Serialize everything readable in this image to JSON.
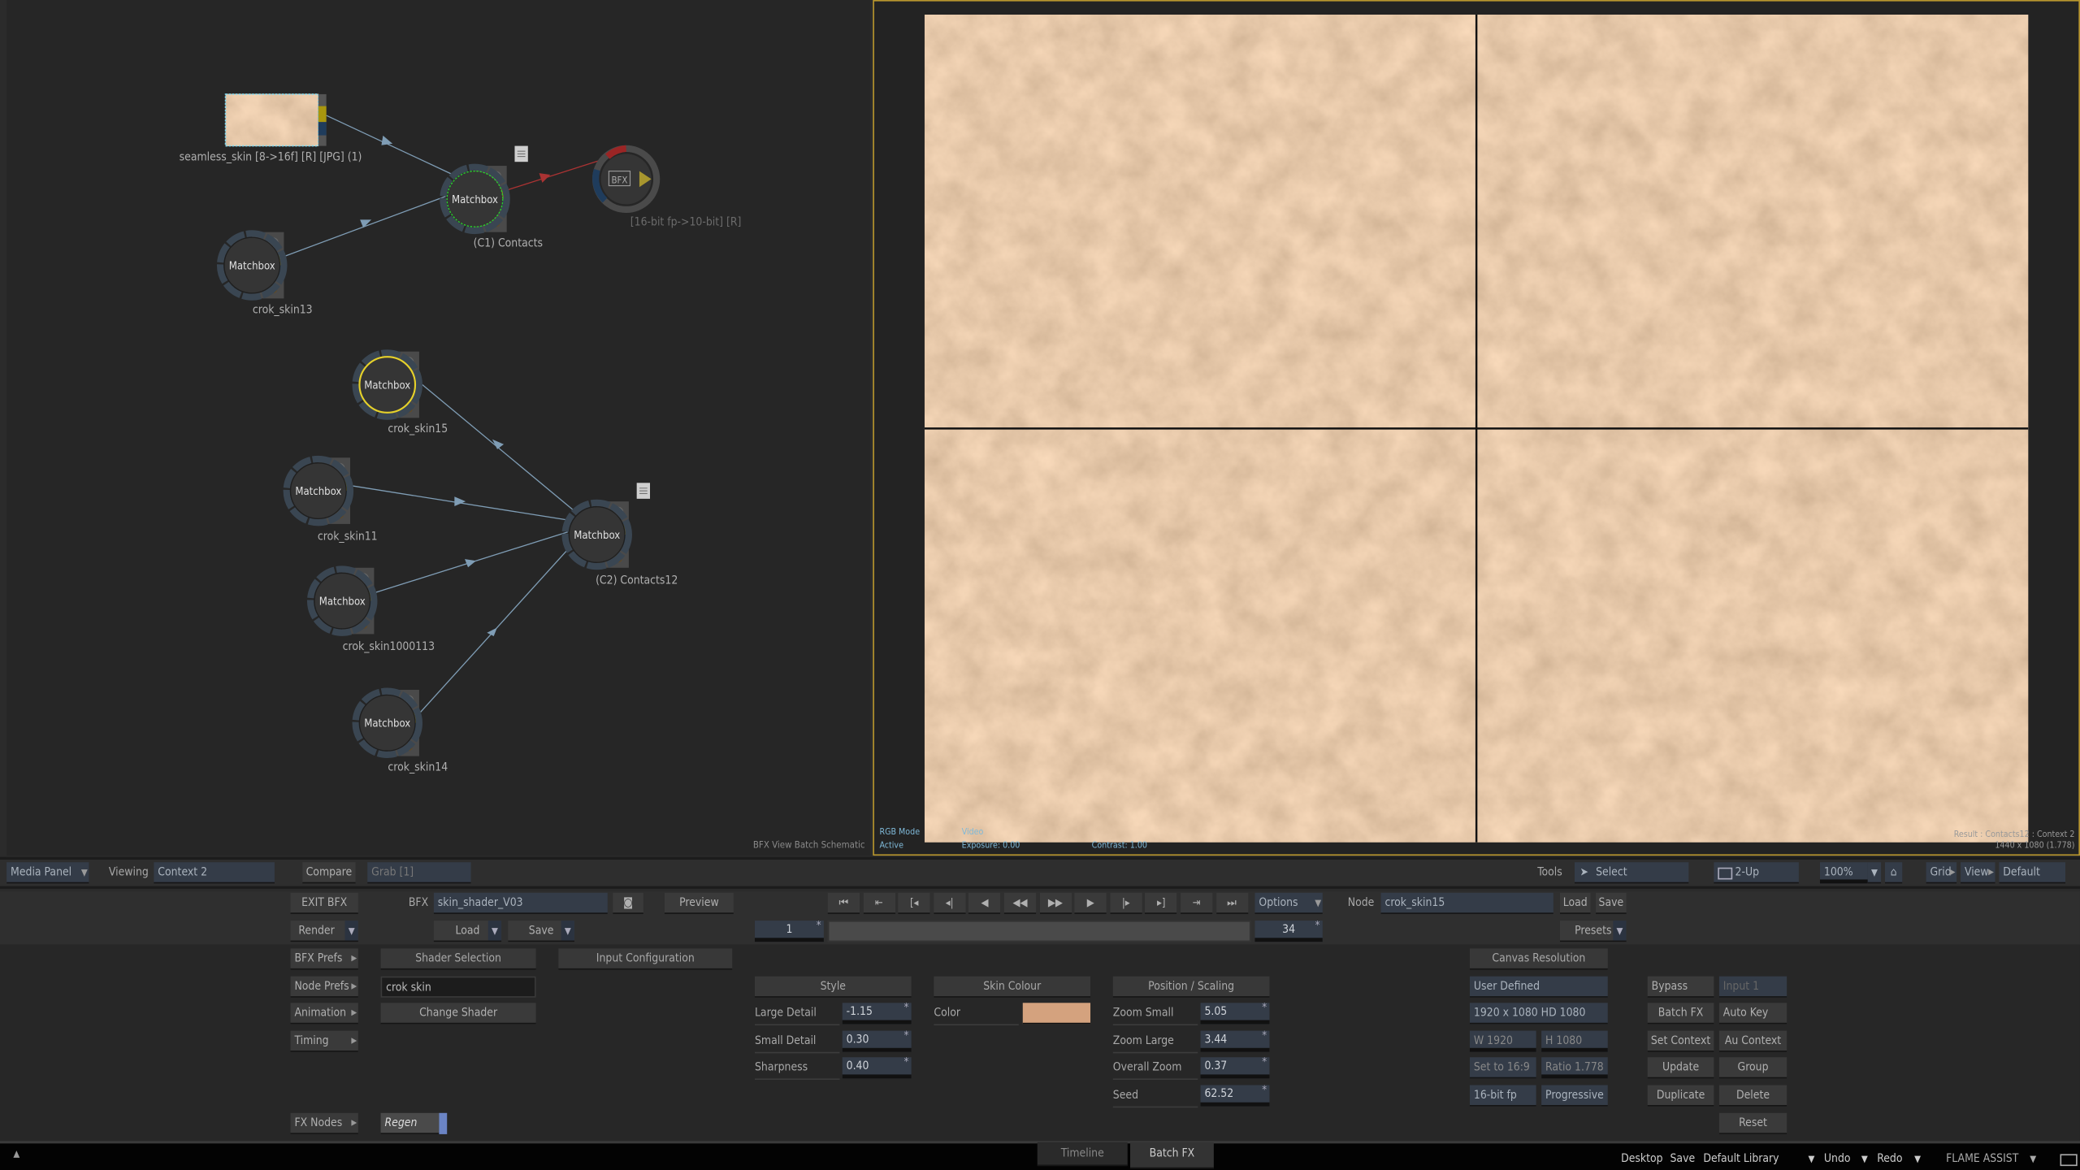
{
  "schematic": {
    "view_label": "BFX View  Batch Schematic",
    "nodes": [
      {
        "label": "seamless_skin [8->16f] [R] [JPG] (1)",
        "type": "clip"
      },
      {
        "title": "Matchbox",
        "label": "(C1) Contacts"
      },
      {
        "title": "BFX",
        "label": "[16-bit fp->10-bit] [R]"
      },
      {
        "title": "Matchbox",
        "label": "crok_skin13"
      },
      {
        "title": "Matchbox",
        "label": "crok_skin15",
        "selected": true
      },
      {
        "title": "Matchbox",
        "label": "crok_skin11"
      },
      {
        "title": "Matchbox",
        "label": "(C2) Contacts12"
      },
      {
        "title": "Matchbox",
        "label": "crok_skin1000113"
      },
      {
        "title": "Matchbox",
        "label": "crok_skin14"
      }
    ]
  },
  "viewer": {
    "rgb_mode": "RGB Mode",
    "active": "Active",
    "video": "Video",
    "exposure": "Exposure: 0.00",
    "contrast": "Contrast: 1.00",
    "result": "Result : Contacts12 : Context 2",
    "resolution": "1440 x 1080 (1.778)",
    "border_color": "#b8962e",
    "skin_color": "#c9966c"
  },
  "topbar": {
    "media_panel": "Media Panel",
    "viewing": "Viewing",
    "context": "Context 2",
    "compare": "Compare",
    "grab": "Grab [1]",
    "tools": "Tools",
    "select": "Select",
    "two_up": "2-Up",
    "zoom": "100%",
    "grid": "Grid",
    "view": "View",
    "default": "Default"
  },
  "bfx": {
    "exit": "EXIT BFX",
    "bfx_label": "BFX",
    "setup_name": "skin_shader_V03",
    "preview": "Preview",
    "render": "Render",
    "load": "Load",
    "save": "Save",
    "options": "Options",
    "node_label": "Node",
    "node_name": "crok_skin15",
    "node_load": "Load",
    "node_save": "Save",
    "presets": "Presets",
    "frame_start": "1",
    "frame_end": "34",
    "transport": [
      "go-start",
      "prev-key",
      "mark-in",
      "prev-frame-key",
      "step-back",
      "play-back",
      "play-forward",
      "step-forward",
      "next-key",
      "mark-out",
      "next-frame-key",
      "go-end"
    ]
  },
  "side": {
    "bfx_prefs": "BFX Prefs",
    "node_prefs": "Node Prefs",
    "animation": "Animation",
    "timing": "Timing",
    "fx_nodes": "FX Nodes",
    "regen": "Regen"
  },
  "shader": {
    "shader_selection": "Shader Selection",
    "input_configuration": "Input Configuration",
    "shader_field": "crok skin",
    "change_shader": "Change Shader"
  },
  "style": {
    "header": "Style",
    "large_detail": {
      "label": "Large Detail",
      "value": "-1.15"
    },
    "small_detail": {
      "label": "Small Detail",
      "value": "0.30"
    },
    "sharpness": {
      "label": "Sharpness",
      "value": "0.40"
    }
  },
  "skin": {
    "header": "Skin Colour",
    "color_label": "Color",
    "color": "#d4a27e"
  },
  "position": {
    "header": "Position / Scaling",
    "zoom_small": {
      "label": "Zoom Small",
      "value": "5.05"
    },
    "zoom_large": {
      "label": "Zoom Large",
      "value": "3.44"
    },
    "overall_zoom": {
      "label": "Overall Zoom",
      "value": "0.37"
    },
    "seed": {
      "label": "Seed",
      "value": "62.52"
    }
  },
  "canvas": {
    "header": "Canvas Resolution",
    "preset": "User Defined",
    "format": "1920 x 1080 HD 1080",
    "w": "W 1920",
    "h": "H 1080",
    "set169": "Set to 16:9",
    "ratio": "Ratio 1.778",
    "depth": "16-bit fp",
    "scan": "Progressive"
  },
  "nodeops": {
    "bypass": "Bypass",
    "input": "Input 1",
    "batch_fx": "Batch FX",
    "auto_key": "Auto Key",
    "set_context": "Set Context",
    "au_context": "Au Context",
    "update": "Update",
    "group": "Group",
    "duplicate": "Duplicate",
    "delete": "Delete",
    "reset": "Reset"
  },
  "bottom": {
    "timeline": "Timeline",
    "batch_fx": "Batch FX",
    "desktop": "Desktop",
    "save": "Save",
    "library": "Default Library",
    "undo": "Undo",
    "redo": "Redo",
    "flame_assist": "FLAME ASSIST"
  }
}
